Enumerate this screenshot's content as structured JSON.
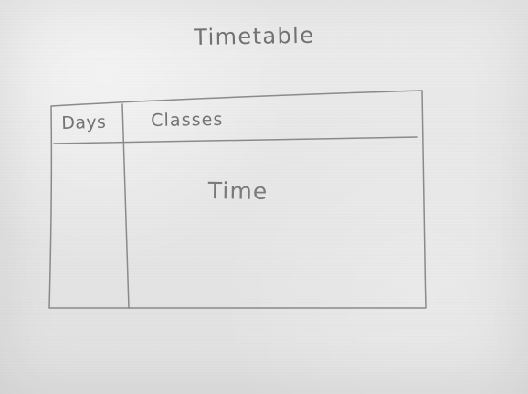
{
  "sketch": {
    "title": "Timetable",
    "table": {
      "header_left": "Days",
      "header_right": "Classes",
      "body_label": "Time"
    }
  }
}
